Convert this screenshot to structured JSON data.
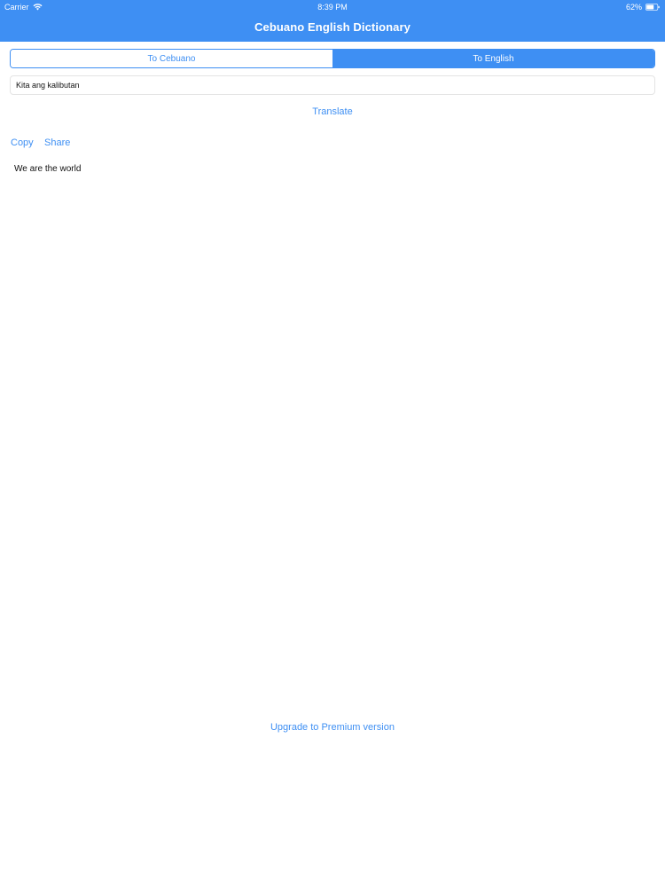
{
  "status_bar": {
    "carrier": "Carrier",
    "time": "8:39 PM",
    "battery": "62%"
  },
  "header": {
    "title": "Cebuano English Dictionary",
    "color": "#3e8ff3"
  },
  "segmented": {
    "options": [
      "To Cebuano",
      "To English"
    ],
    "selected": "To English"
  },
  "input": {
    "value": "Kita ang kalibutan"
  },
  "actions": {
    "translate": "Translate",
    "copy": "Copy",
    "share": "Share",
    "upgrade": "Upgrade to Premium version"
  },
  "result": {
    "text": "We are the world"
  },
  "icons": {
    "wifi": "wifi-icon",
    "battery": "battery-icon"
  }
}
